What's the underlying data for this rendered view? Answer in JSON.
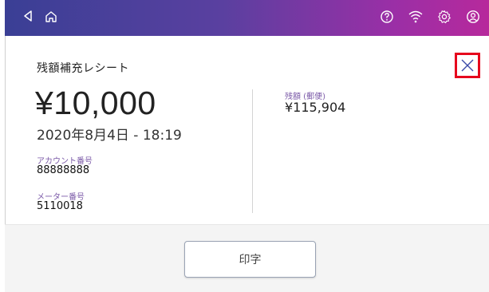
{
  "header": {
    "icons": [
      "back-icon",
      "home-icon",
      "help-icon",
      "wifi-icon",
      "settings-icon",
      "account-icon"
    ]
  },
  "receipt": {
    "title": "残額補充レシート",
    "amount": "¥10,000",
    "datetime": "2020年8月4日 - 18:19",
    "account_label": "アカウント番号",
    "account_value": "88888888",
    "meter_label": "メーター番号",
    "meter_value": "5110018",
    "balance_label": "残額 (郵便)",
    "balance_value": "¥115,904"
  },
  "footer": {
    "print_label": "印字"
  },
  "colors": {
    "header_start": "#3a3f95",
    "header_end": "#b7299c",
    "highlight": "#e6061d",
    "label_purple": "#7b5aa8"
  }
}
